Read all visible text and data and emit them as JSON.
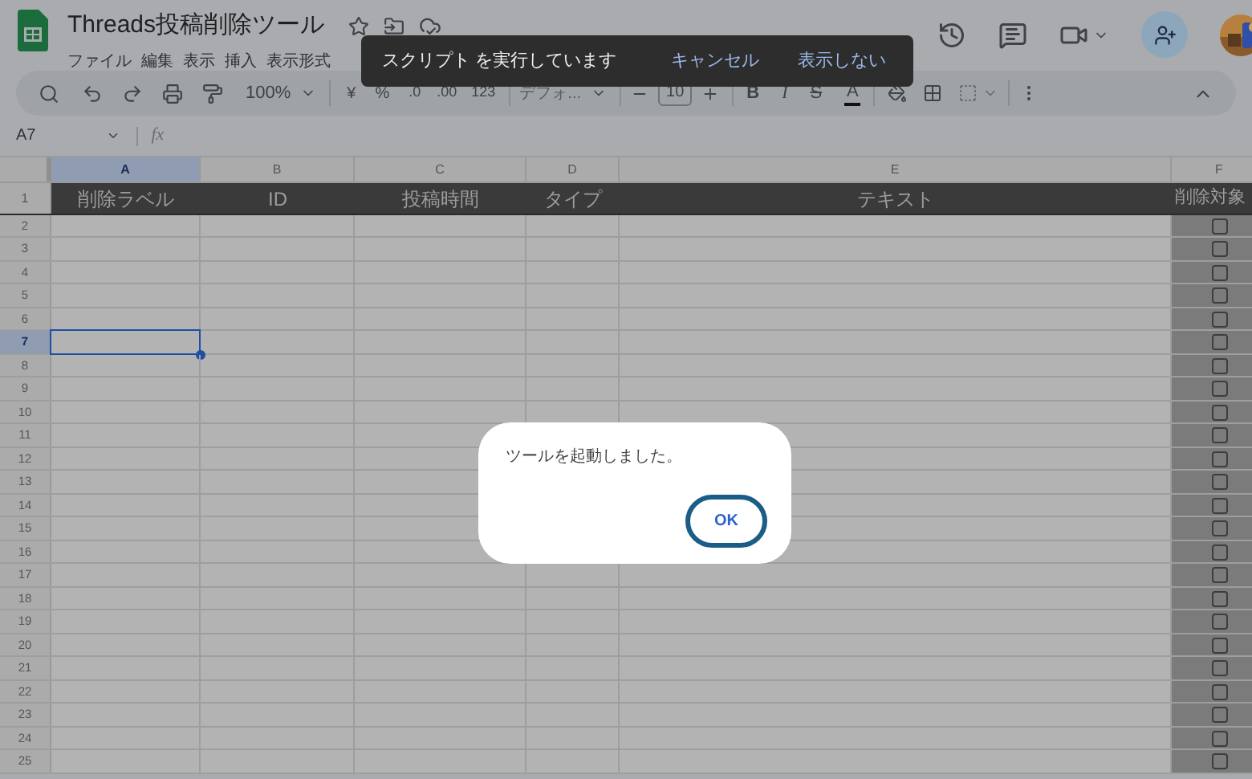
{
  "app": {
    "title": "Threads投稿削除ツール",
    "menu": [
      "ファイル",
      "編集",
      "表示",
      "挿入",
      "表示形式"
    ]
  },
  "toolbar": {
    "zoom": "100%",
    "currency": "¥",
    "percent": "%",
    "decimal_decrease": ".0",
    "decimal_increase": ".00",
    "number_format": "123",
    "font": "デフォ...",
    "font_size": "10",
    "bold": "B",
    "italic": "I",
    "strikethrough": "S",
    "text_color": "A"
  },
  "toast": {
    "message": "スクリプト を実行しています",
    "actions": [
      "キャンセル",
      "表示しない"
    ]
  },
  "formula_bar": {
    "name_box": "A7",
    "function_label": "fx"
  },
  "sheet": {
    "header_row": "1",
    "columns": [
      {
        "letter": "A",
        "header": "削除ラベル",
        "selected": true
      },
      {
        "letter": "B",
        "header": "ID",
        "selected": false
      },
      {
        "letter": "C",
        "header": "投稿時間",
        "selected": false
      },
      {
        "letter": "D",
        "header": "タイプ",
        "selected": false
      },
      {
        "letter": "E",
        "header": "テキスト",
        "selected": false
      },
      {
        "letter": "F",
        "header": "削除対象",
        "selected": false
      }
    ],
    "rows": [
      {
        "number": "2",
        "selected": false,
        "checked": false
      },
      {
        "number": "3",
        "selected": false,
        "checked": false
      },
      {
        "number": "4",
        "selected": false,
        "checked": false
      },
      {
        "number": "5",
        "selected": false,
        "checked": false
      },
      {
        "number": "6",
        "selected": false,
        "checked": false
      },
      {
        "number": "7",
        "selected": true,
        "checked": false
      },
      {
        "number": "8",
        "selected": false,
        "checked": false
      },
      {
        "number": "9",
        "selected": false,
        "checked": false
      },
      {
        "number": "10",
        "selected": false,
        "checked": false
      },
      {
        "number": "11",
        "selected": false,
        "checked": false
      },
      {
        "number": "12",
        "selected": false,
        "checked": false
      },
      {
        "number": "13",
        "selected": false,
        "checked": false
      },
      {
        "number": "14",
        "selected": false,
        "checked": false
      },
      {
        "number": "15",
        "selected": false,
        "checked": false
      },
      {
        "number": "16",
        "selected": false,
        "checked": false
      },
      {
        "number": "17",
        "selected": false,
        "checked": false
      },
      {
        "number": "18",
        "selected": false,
        "checked": false
      },
      {
        "number": "19",
        "selected": false,
        "checked": false
      },
      {
        "number": "20",
        "selected": false,
        "checked": false
      },
      {
        "number": "21",
        "selected": false,
        "checked": false
      },
      {
        "number": "22",
        "selected": false,
        "checked": false
      },
      {
        "number": "23",
        "selected": false,
        "checked": false
      },
      {
        "number": "24",
        "selected": false,
        "checked": false
      },
      {
        "number": "25",
        "selected": false,
        "checked": false
      }
    ]
  },
  "dialog": {
    "message": "ツールを起動しました。",
    "button": "OK"
  }
}
